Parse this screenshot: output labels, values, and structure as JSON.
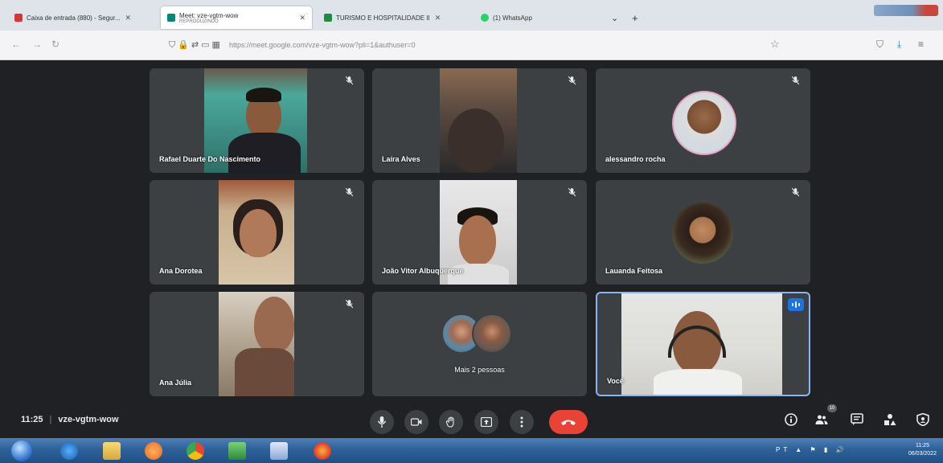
{
  "browser": {
    "tabs": [
      {
        "label": "Caixa de entrada (880) - Segur...",
        "active": false
      },
      {
        "label": "Meet: vze-vgtm-wow",
        "sublabel": "REPRODUZINDO",
        "active": true
      },
      {
        "label": "TURISMO E HOSPITALIDADE II",
        "active": false
      },
      {
        "label": "(1) WhatsApp",
        "active": false
      }
    ],
    "new_tab": "+",
    "tab_list": "⌄",
    "url": "https://meet.google.com/vze-vgtm-wow?pli=1&authuser=0"
  },
  "meeting": {
    "time": "11:25",
    "code": "vze-vgtm-wow",
    "people_count": "10",
    "participants": [
      {
        "name": "Rafael Duarte Do Nascimento",
        "muted": true,
        "type": "video"
      },
      {
        "name": "Laíra Alves",
        "muted": true,
        "type": "video"
      },
      {
        "name": "alessandro rocha",
        "muted": true,
        "type": "avatar"
      },
      {
        "name": "Ana Dorotea",
        "muted": true,
        "type": "video"
      },
      {
        "name": "João Vitor Albuquerque",
        "muted": true,
        "type": "video"
      },
      {
        "name": "Lauanda Feitosa",
        "muted": true,
        "type": "avatar"
      },
      {
        "name": "Ana Júlia",
        "muted": true,
        "type": "video"
      },
      {
        "name": "Mais 2 pessoas",
        "muted": false,
        "type": "more"
      },
      {
        "name": "Você",
        "muted": false,
        "type": "self",
        "speaking": true
      }
    ]
  },
  "taskbar": {
    "time": "11:25",
    "date": "06/03/2022",
    "tray_lang": "PT"
  },
  "colors": {
    "meet_bg": "#202124",
    "tile_bg": "#3c4043",
    "end_call": "#ea4335",
    "accent": "#1a73e8"
  }
}
